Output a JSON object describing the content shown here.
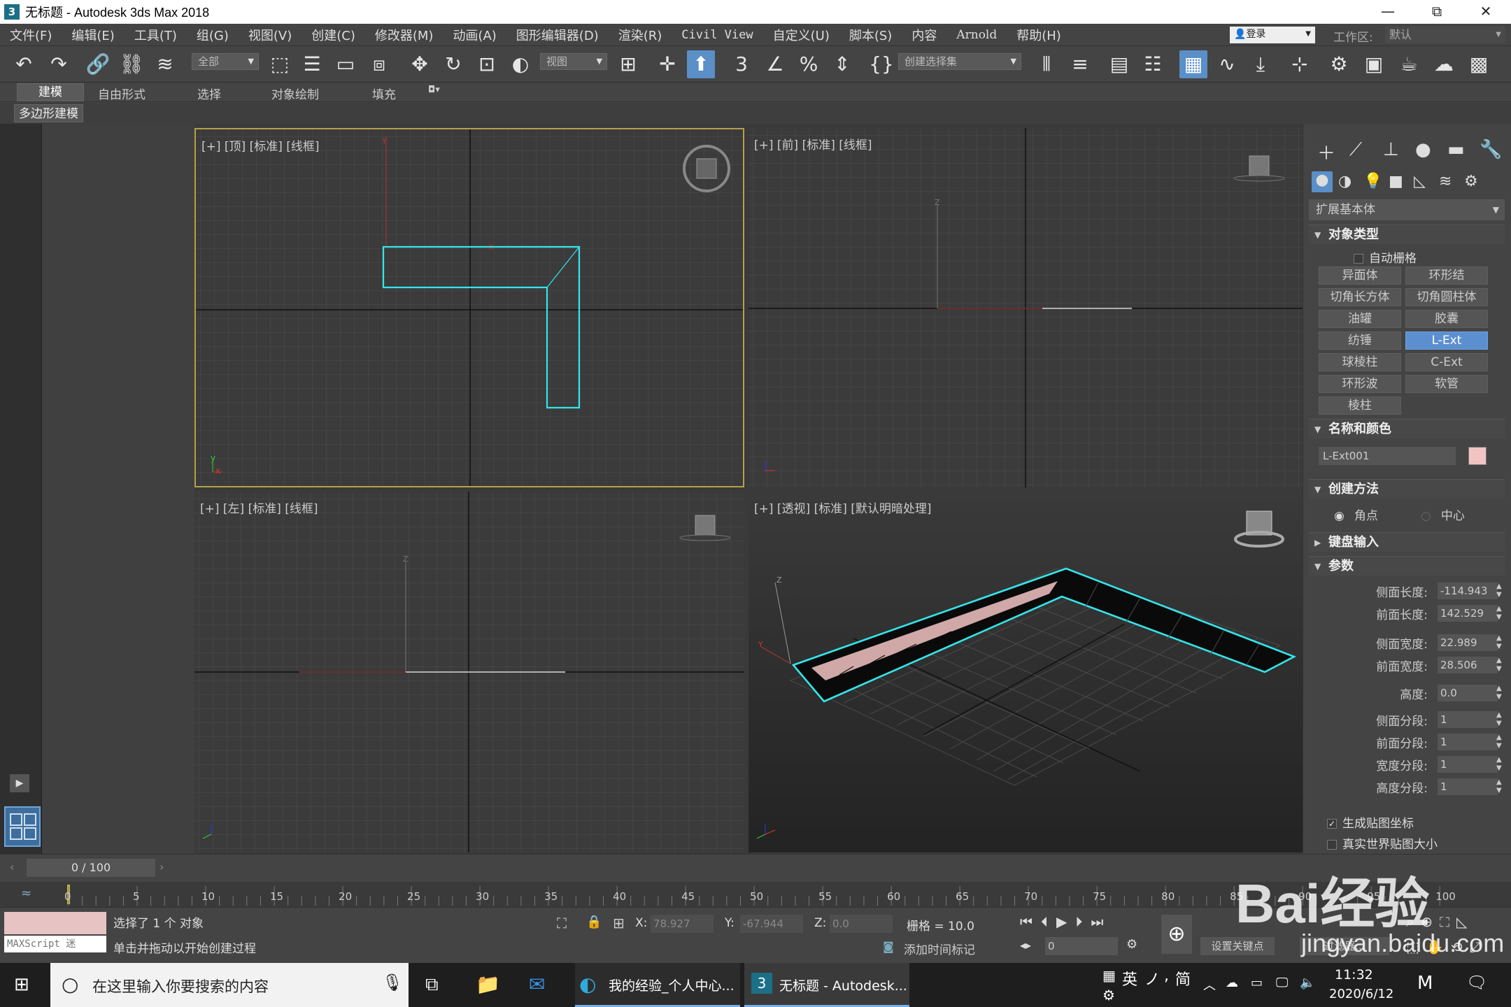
{
  "window": {
    "title": "无标题 - Autodesk 3ds Max 2018",
    "minimize": "—",
    "maximize": "⧉",
    "close": "✕"
  },
  "menu": [
    "文件(F)",
    "编辑(E)",
    "工具(T)",
    "组(G)",
    "视图(V)",
    "创建(C)",
    "修改器(M)",
    "动画(A)",
    "图形编辑器(D)",
    "渲染(R)",
    "Civil View",
    "自定义(U)",
    "脚本(S)",
    "内容",
    "Arnold",
    "帮助(H)"
  ],
  "login": {
    "label": "登录",
    "workspace_label": "工作区:",
    "workspace_value": "默认"
  },
  "toolbar": {
    "selection_filter": "全部",
    "ref_coord": "视图",
    "named_selection": "创建选择集"
  },
  "ribbon": {
    "tabs": [
      "建模",
      "自由形式",
      "选择",
      "对象绘制",
      "填充"
    ],
    "active": "建模",
    "sub": "多边形建模"
  },
  "viewports": {
    "top": "[+] [顶] [标准] [线框]",
    "front": "[+] [前] [标准] [线框]",
    "left": "[+] [左] [标准] [线框]",
    "persp": "[+] [透视] [标准] [默认明暗处理]"
  },
  "command_panel": {
    "category": "扩展基本体",
    "rollouts": {
      "object_type": "对象类型",
      "name_color": "名称和颜色",
      "creation": "创建方法",
      "keyboard": "键盘输入",
      "params": "参数"
    },
    "auto_grid": "自动栅格",
    "buttons": [
      "异面体",
      "环形结",
      "切角长方体",
      "切角圆柱体",
      "油罐",
      "胶囊",
      "纺锤",
      "L-Ext",
      "球棱柱",
      "C-Ext",
      "环形波",
      "软管",
      "棱柱"
    ],
    "active_button": "L-Ext",
    "object_name": "L-Ext001",
    "object_color": "#f2c4c4",
    "creation_methods": [
      "角点",
      "中心"
    ],
    "params": [
      {
        "label": "侧面长度:",
        "value": "-114.943"
      },
      {
        "label": "前面长度:",
        "value": "142.529"
      },
      {
        "label": "侧面宽度:",
        "value": "22.989"
      },
      {
        "label": "前面宽度:",
        "value": "28.506"
      },
      {
        "label": "高度:",
        "value": "0.0"
      },
      {
        "label": "侧面分段:",
        "value": "1"
      },
      {
        "label": "前面分段:",
        "value": "1"
      },
      {
        "label": "宽度分段:",
        "value": "1"
      },
      {
        "label": "高度分段:",
        "value": "1"
      }
    ],
    "checks": [
      {
        "label": "生成贴图坐标",
        "checked": true
      },
      {
        "label": "真实世界贴图大小",
        "checked": false
      }
    ]
  },
  "timeline": {
    "frame": "0 / 100",
    "ticks": [
      "0",
      "5",
      "10",
      "15",
      "20",
      "25",
      "30",
      "35",
      "40",
      "45",
      "50",
      "55",
      "60",
      "65",
      "70",
      "75",
      "80",
      "85",
      "90",
      "95",
      "100"
    ]
  },
  "status": {
    "maxscript": "MAXScript 迷",
    "selected": "选择了 1 个 对象",
    "prompt": "单击并拖动以开始创建过程",
    "x_label": "X:",
    "x": "78.927",
    "y_label": "Y:",
    "y": "-67.944",
    "z_label": "Z:",
    "z": "0.0",
    "grid": "栅格 = 10.0",
    "add_time_tag": "添加时间标记",
    "frame_field": "0",
    "set_key": "设置关键点",
    "filter": "过滤器..."
  },
  "taskbar": {
    "search": "在这里输入你要搜索的内容",
    "edge_app": "我的经验_个人中心...",
    "max_app": "无标题 - Autodesk...",
    "ime": "英",
    "ime2": "简",
    "time": "11:32",
    "date": "2020/6/12"
  },
  "watermark": {
    "text": "Bai经验",
    "url": "jingyan.baidu.com"
  }
}
